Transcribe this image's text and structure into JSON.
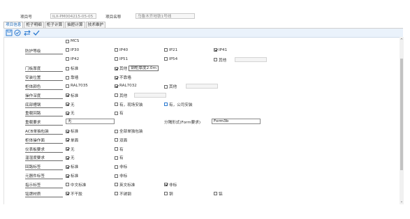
{
  "header": {
    "project_no_label": "项目号",
    "project_no_value": "ILX-PM004215-05-05",
    "project_name_label": "项目名称",
    "project_name_value": "乌鲁木齐地铁1号线"
  },
  "tabs": [
    "项目信息",
    "柜子明细",
    "柜子计算",
    "抽屉计算",
    "技术维护"
  ],
  "toolbar": [
    "save-icon",
    "check-circle-icon",
    "swap-icon",
    "checkmark-icon"
  ],
  "rows": [
    {
      "label": "",
      "options": [
        {
          "text": "MCS",
          "checked": false
        }
      ]
    },
    {
      "label": "防护等级",
      "options": [
        {
          "text": "IP30",
          "checked": false
        },
        {
          "text": "IP40",
          "checked": false
        },
        {
          "text": "IP21",
          "checked": false
        },
        {
          "text": "IP41",
          "checked": true
        }
      ]
    },
    {
      "label": "",
      "options": [
        {
          "text": "IP42",
          "checked": false
        },
        {
          "text": "IP51",
          "checked": false
        },
        {
          "text": "IP54",
          "checked": false
        },
        {
          "text": "其他",
          "checked": false
        }
      ]
    },
    {
      "label": "门板厚度",
      "options": [
        {
          "text": "标准",
          "checked": false
        },
        {
          "text": "其他",
          "checked": true,
          "button": "钢柜厚度2.0m"
        }
      ]
    },
    {
      "label": "安装位置",
      "options": [
        {
          "text": "靠墙",
          "checked": false
        },
        {
          "text": "不靠墙",
          "checked": true
        }
      ]
    },
    {
      "label": "柜体颜色",
      "options": [
        {
          "text": "RAL7035",
          "checked": false
        },
        {
          "text": "RAL7032",
          "checked": true
        },
        {
          "text": "其他",
          "checked": false
        }
      ]
    },
    {
      "label": "操作深度",
      "options": [
        {
          "text": "标准",
          "checked": true
        },
        {
          "text": "其他",
          "checked": false
        }
      ]
    },
    {
      "label": "底部槽钢",
      "options": [
        {
          "text": "无",
          "checked": true
        },
        {
          "text": "有，现场安装",
          "checked": false
        },
        {
          "text": "有，公司安装",
          "checked": false
        }
      ]
    },
    {
      "label": "重载回路",
      "options": [
        {
          "text": "无",
          "checked": true
        },
        {
          "text": "有",
          "checked": false
        }
      ]
    },
    {
      "label": "重载要求",
      "text_value": "无",
      "right_label": "分隔形式(Form要求)",
      "right_value": "Form3b"
    },
    {
      "label": "ACB单抽包装",
      "options": [
        {
          "text": "标准",
          "checked": true
        },
        {
          "text": "全部单独包装",
          "checked": false
        }
      ]
    },
    {
      "label": "柜体操作面",
      "options": [
        {
          "text": "单面",
          "checked": true
        },
        {
          "text": "双面",
          "checked": false
        }
      ]
    },
    {
      "label": "仪表板要求",
      "options": [
        {
          "text": "无",
          "checked": true
        },
        {
          "text": "有",
          "checked": false
        }
      ]
    },
    {
      "label": "温湿度要求",
      "options": [
        {
          "text": "无",
          "checked": true
        },
        {
          "text": "有",
          "checked": false
        }
      ]
    },
    {
      "label": "回路标签",
      "options": [
        {
          "text": "标准",
          "checked": true
        },
        {
          "text": "非标",
          "checked": false
        }
      ]
    },
    {
      "label": "元器件标签",
      "options": [
        {
          "text": "标准",
          "checked": true
        },
        {
          "text": "非标",
          "checked": false
        }
      ]
    },
    {
      "label": "指示标签",
      "options": [
        {
          "text": "中文标准",
          "checked": false
        },
        {
          "text": "英文标准",
          "checked": false
        },
        {
          "text": "非标",
          "checked": true
        }
      ]
    },
    {
      "label": "铭牌材质",
      "options": [
        {
          "text": "不干胶",
          "checked": true
        },
        {
          "text": "不锈钢",
          "checked": false
        },
        {
          "text": "铜",
          "checked": false
        },
        {
          "text": "铝",
          "checked": false
        }
      ]
    }
  ],
  "colors": {
    "accent": "#1a66b3",
    "toolbar_bg": "#eaf2fb"
  }
}
